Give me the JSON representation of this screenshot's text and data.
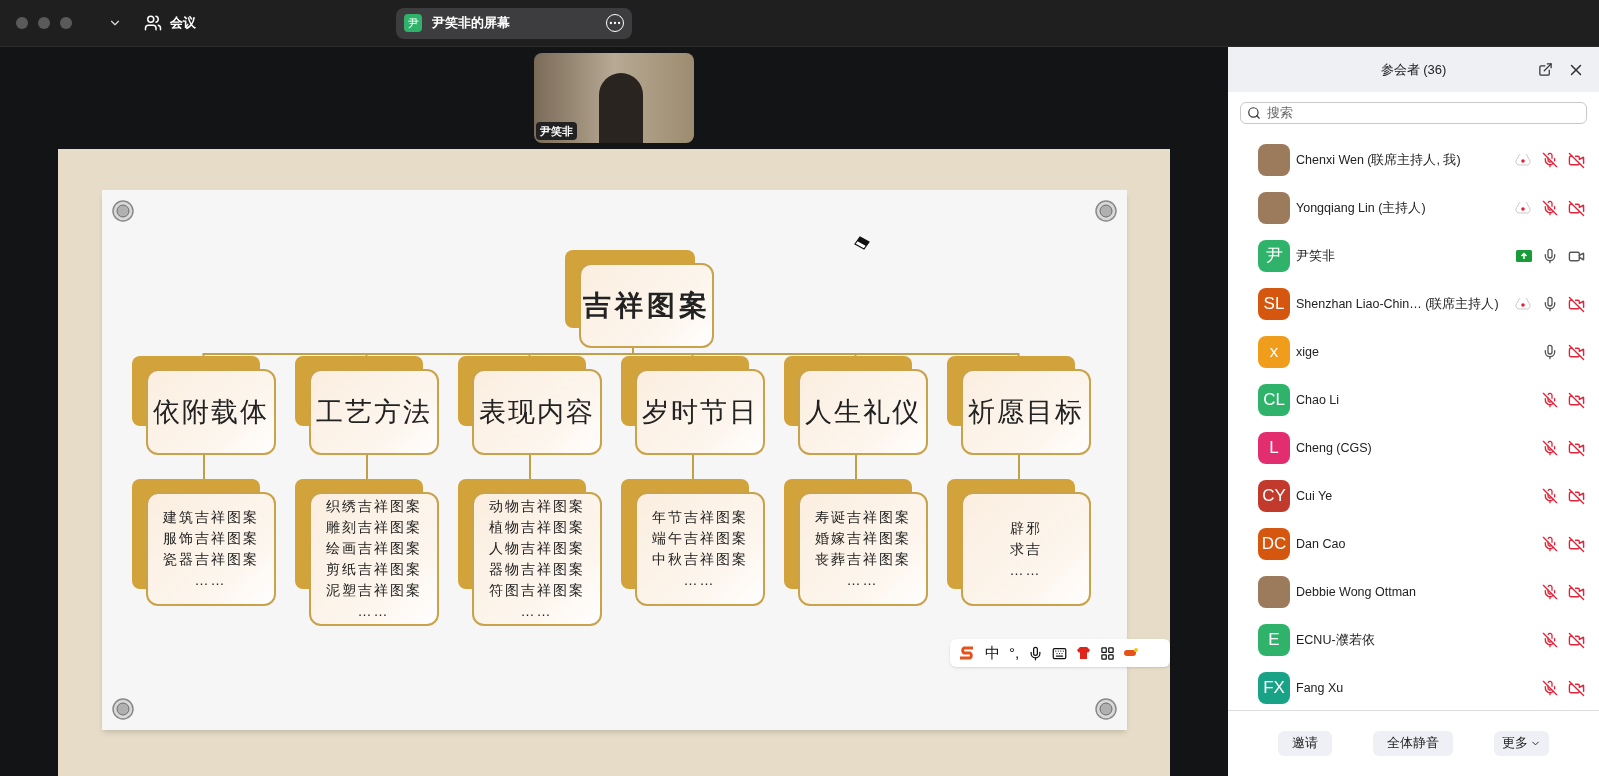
{
  "top_bar": {
    "menu_label": "会议",
    "share_tab": {
      "initial": "尹",
      "title": "尹笑非的屏幕"
    }
  },
  "video_tile": {
    "name": "尹笑非"
  },
  "slide": {
    "root": "吉祥图案",
    "categories": [
      {
        "label": "依附载体",
        "items": [
          "建筑吉祥图案",
          "服饰吉祥图案",
          "瓷器吉祥图案",
          "……"
        ]
      },
      {
        "label": "工艺方法",
        "items": [
          "织绣吉祥图案",
          "雕刻吉祥图案",
          "绘画吉祥图案",
          "剪纸吉祥图案",
          "泥塑吉祥图案",
          "……"
        ]
      },
      {
        "label": "表现内容",
        "items": [
          "动物吉祥图案",
          "植物吉祥图案",
          "人物吉祥图案",
          "器物吉祥图案",
          "符图吉祥图案",
          "……"
        ]
      },
      {
        "label": "岁时节日",
        "items": [
          "年节吉祥图案",
          "端午吉祥图案",
          "中秋吉祥图案",
          "……"
        ]
      },
      {
        "label": "人生礼仪",
        "items": [
          "寿诞吉祥图案",
          "婚嫁吉祥图案",
          "丧葬吉祥图案",
          "……"
        ]
      },
      {
        "label": "祈愿目标",
        "items": [
          "辟邪",
          "求吉",
          "……"
        ]
      }
    ]
  },
  "ime_toolbar": {
    "mode": "中",
    "punctuation": "°,"
  },
  "participants_panel": {
    "title": "参会者 (36)",
    "search": {
      "placeholder": "搜索"
    },
    "participants": [
      {
        "name": "Chenxi Wen (联席主持人, 我)",
        "avatar": {
          "kind": "photo"
        },
        "recording": true,
        "sharing": false,
        "muted": true,
        "video_off": true
      },
      {
        "name": "Yongqiang Lin (主持人)",
        "avatar": {
          "kind": "photo"
        },
        "recording": true,
        "sharing": false,
        "muted": true,
        "video_off": true
      },
      {
        "name": "尹笑非",
        "avatar": {
          "kind": "initials",
          "initials": "尹",
          "color": "#2fb36a"
        },
        "recording": false,
        "sharing": true,
        "muted": false,
        "video_off": false
      },
      {
        "name": "Shenzhan Liao-Chin… (联席主持人)",
        "avatar": {
          "kind": "initials",
          "initials": "SL",
          "color": "#d4560f"
        },
        "recording": true,
        "sharing": false,
        "muted": false,
        "video_off": true
      },
      {
        "name": "xige",
        "avatar": {
          "kind": "initials",
          "initials": "x",
          "color": "#f09d1c"
        },
        "recording": false,
        "sharing": false,
        "muted": false,
        "video_off": true
      },
      {
        "name": "Chao Li",
        "avatar": {
          "kind": "initials",
          "initials": "CL",
          "color": "#2fb36a"
        },
        "recording": false,
        "sharing": false,
        "muted": true,
        "video_off": true
      },
      {
        "name": "Cheng (CGS)",
        "avatar": {
          "kind": "initials",
          "initials": "L",
          "color": "#e22e6e"
        },
        "recording": false,
        "sharing": false,
        "muted": true,
        "video_off": true
      },
      {
        "name": "Cui Ye",
        "avatar": {
          "kind": "initials",
          "initials": "CY",
          "color": "#c23a2c"
        },
        "recording": false,
        "sharing": false,
        "muted": true,
        "video_off": true
      },
      {
        "name": "Dan Cao",
        "avatar": {
          "kind": "initials",
          "initials": "DC",
          "color": "#d4560f"
        },
        "recording": false,
        "sharing": false,
        "muted": true,
        "video_off": true
      },
      {
        "name": "Debbie Wong Ottman",
        "avatar": {
          "kind": "photo"
        },
        "recording": false,
        "sharing": false,
        "muted": true,
        "video_off": true
      },
      {
        "name": "ECNU-濮若依",
        "avatar": {
          "kind": "initials",
          "initials": "E",
          "color": "#2fb36a"
        },
        "recording": false,
        "sharing": false,
        "muted": true,
        "video_off": true
      },
      {
        "name": "Fang Xu",
        "avatar": {
          "kind": "initials",
          "initials": "FX",
          "color": "#18a387"
        },
        "recording": false,
        "sharing": false,
        "muted": true,
        "video_off": true
      }
    ],
    "buttons": [
      "邀请",
      "全体静音"
    ],
    "more_button": "更多"
  }
}
